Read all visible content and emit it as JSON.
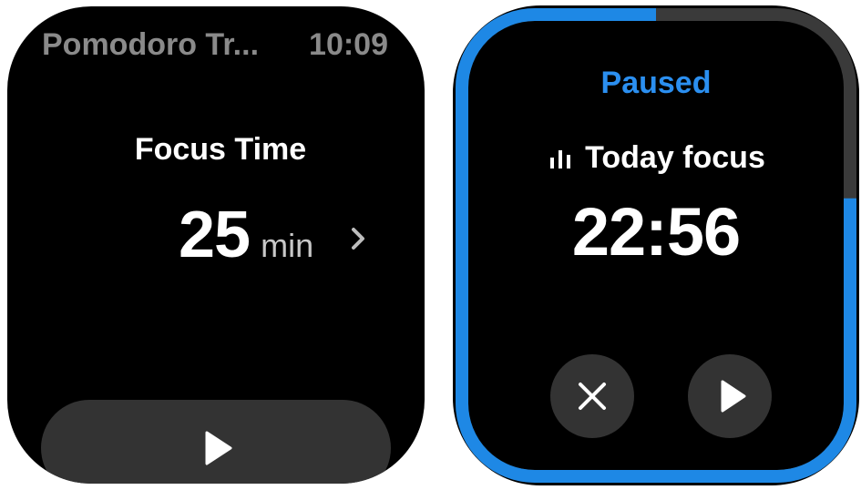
{
  "left_screen": {
    "app_title": "Pomodoro Tr...",
    "clock": "10:09",
    "focus_label": "Focus Time",
    "duration_value": "25",
    "duration_unit": "min",
    "chevron_icon": "chevron-right-icon",
    "start_icon": "play-icon"
  },
  "right_screen": {
    "status": "Paused",
    "stats_icon": "bar-chart-icon",
    "today_label": "Today focus",
    "timer": "22:56",
    "stop_icon": "close-icon",
    "resume_icon": "play-icon",
    "progress": 0.78
  },
  "colors": {
    "background": "#000000",
    "accent": "#1e88e5",
    "status_text": "#2b8ff0",
    "button_bg": "#333333",
    "muted_text": "#8a8a8a"
  }
}
